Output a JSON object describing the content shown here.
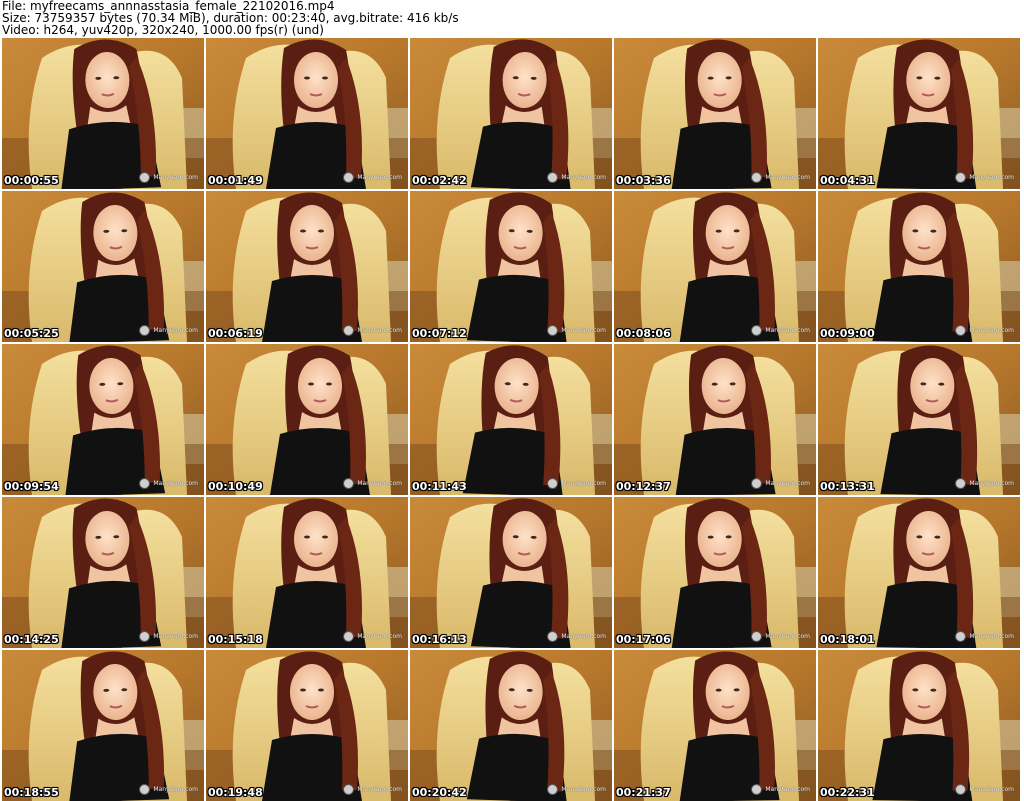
{
  "header": {
    "line1": "File: myfreecams_annnasstasia_female_22102016.mp4",
    "line2": "Size: 73759357 bytes (70.34 MiB), duration: 00:23:40, avg.bitrate: 416 kb/s",
    "line3": "Video: h264, yuv420p, 320x240, 1000.00 fps(r) (und)"
  },
  "watermark": "ManyCam.com",
  "thumbnails": [
    "00:00:55",
    "00:01:49",
    "00:02:42",
    "00:03:36",
    "00:04:31",
    "00:05:25",
    "00:06:19",
    "00:07:12",
    "00:08:06",
    "00:09:00",
    "00:09:54",
    "00:10:49",
    "00:11:43",
    "00:12:37",
    "00:13:31",
    "00:14:25",
    "00:15:18",
    "00:16:13",
    "00:17:06",
    "00:18:01",
    "00:18:55",
    "00:19:48",
    "00:20:42",
    "00:21:37",
    "00:22:31"
  ]
}
